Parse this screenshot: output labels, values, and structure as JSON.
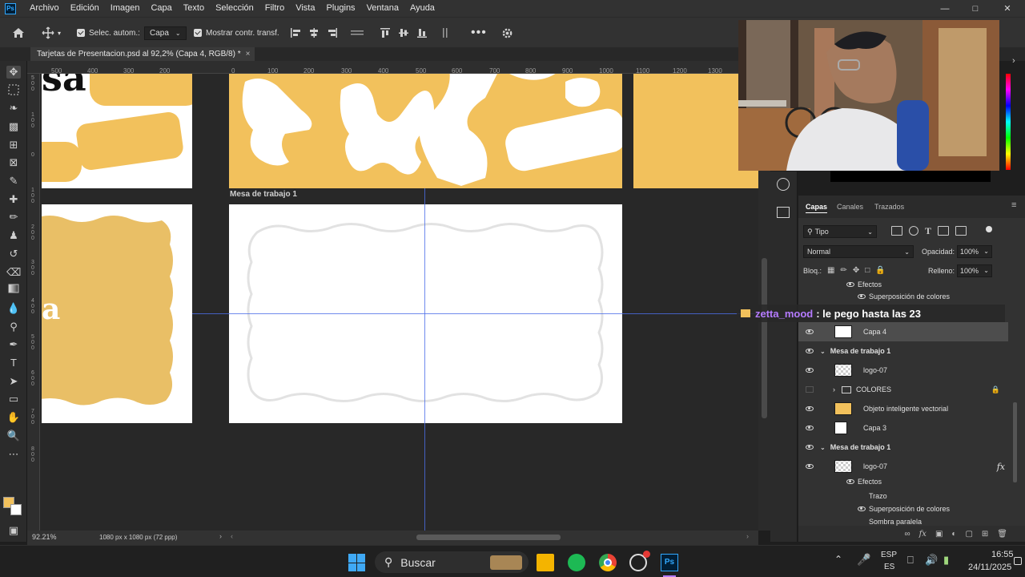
{
  "menubar": {
    "items": [
      "Archivo",
      "Edición",
      "Imagen",
      "Capa",
      "Texto",
      "Selección",
      "Filtro",
      "Vista",
      "Plugins",
      "Ventana",
      "Ayuda"
    ]
  },
  "options": {
    "auto_select_label": "Selec. autom.:",
    "auto_select_value": "Capa",
    "show_transform_label": "Mostrar contr. transf."
  },
  "document": {
    "tab_title": "Tarjetas de Presentacion.psd al 92,2% (Capa 4, RGB/8) *",
    "close_glyph": "×",
    "artboard_label": "Mesa de trabajo 1"
  },
  "ruler": {
    "top_ticks": [
      "500",
      "400",
      "300",
      "200",
      "0",
      "100",
      "200",
      "300",
      "400",
      "500",
      "600",
      "700",
      "800",
      "900",
      "1000",
      "1100",
      "1200",
      "1300"
    ],
    "left_ticks": [
      "5\n0\n0",
      "1\n0\n0",
      "0",
      "1\n0\n0",
      "2\n0\n0",
      "3\n0\n0",
      "4\n0\n0",
      "5\n0\n0",
      "6\n0\n0",
      "7\n0\n0",
      "8\n0\n0"
    ]
  },
  "status": {
    "zoom": "92.21%",
    "doc_info": "1080 px x 1080 px (72 ppp)"
  },
  "layers_panel": {
    "tabs": [
      "Capas",
      "Canales",
      "Trazados"
    ],
    "filter_label": "Tipo",
    "blend_mode": "Normal",
    "opacity_label": "Opacidad:",
    "opacity_value": "100%",
    "lock_label": "Bloq.:",
    "fill_label": "Relleno:",
    "fill_value": "100%",
    "rows": [
      {
        "label": "Efectos"
      },
      {
        "label": "Superposición de colores"
      },
      {
        "label": "Capa 4"
      },
      {
        "label": "Mesa de trabajo 1"
      },
      {
        "label": "logo-07"
      },
      {
        "label": "COLORES"
      },
      {
        "label": "Objeto inteligente vectorial"
      },
      {
        "label": "Capa 3"
      },
      {
        "label": "Mesa de trabajo 1"
      },
      {
        "label": "logo-07"
      },
      {
        "label": "Efectos"
      },
      {
        "label": "Trazo"
      },
      {
        "label": "Superposición de colores"
      },
      {
        "label": "Sombra paralela"
      }
    ],
    "fx_label": "fx"
  },
  "chat": {
    "username": "zetta_mood",
    "message": ": le pego hasta las 23"
  },
  "canvas": {
    "partial_text_top": "sa",
    "partial_text_left": "a"
  },
  "taskbar": {
    "search_label": "Buscar",
    "lang_top": "ESP",
    "lang_bottom": "ES",
    "time": "16:55",
    "date": "24/11/2025"
  },
  "colors": {
    "accent_yellow": "#f2c15c",
    "username_purple": "#b57bff",
    "guide_blue": "#4b6ee8"
  }
}
